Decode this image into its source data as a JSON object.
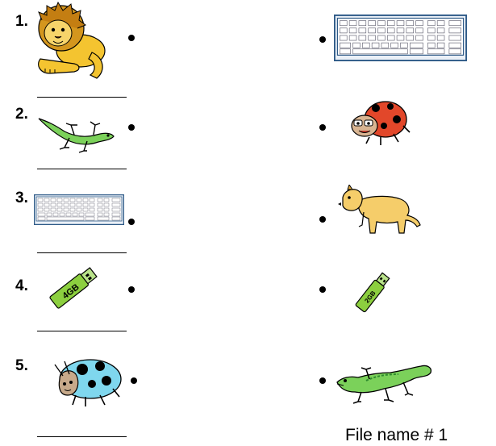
{
  "worksheet": {
    "left_items": [
      {
        "number": "1.",
        "picture": "lion"
      },
      {
        "number": "2.",
        "picture": "green-lizard"
      },
      {
        "number": "3.",
        "picture": "keyboard"
      },
      {
        "number": "4.",
        "picture": "usb-flash-drive",
        "label": "4GB"
      },
      {
        "number": "5.",
        "picture": "blue-ladybug"
      }
    ],
    "right_items": [
      {
        "picture": "keyboard"
      },
      {
        "picture": "red-ladybug"
      },
      {
        "picture": "lioness"
      },
      {
        "picture": "usb-flash-drive",
        "label": "2GB"
      },
      {
        "picture": "green-lizard"
      }
    ]
  },
  "footer": {
    "file_name": "File name # 1"
  },
  "colors": {
    "lion": "#f4c430",
    "lizard": "#7bd15a",
    "keyboard_frame": "#2e5a87",
    "usb": "#8ccf3f",
    "blue_bug": "#7fd7ee",
    "red_bug": "#e2472a"
  }
}
